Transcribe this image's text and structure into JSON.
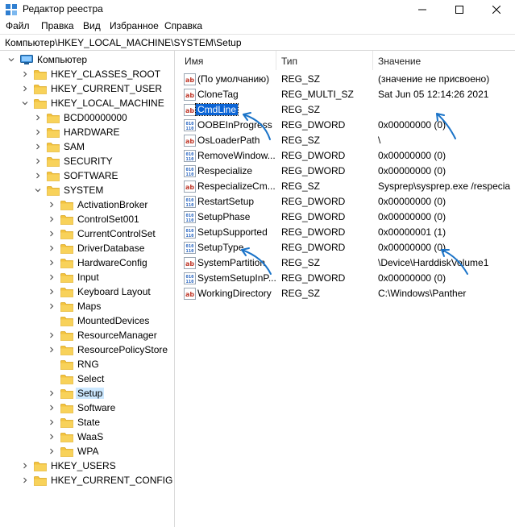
{
  "window": {
    "title": "Редактор реестра",
    "icon": "regedit-icon",
    "controls": [
      "minimize-icon",
      "maximize-icon",
      "close-icon"
    ]
  },
  "menu": {
    "items": [
      "Файл",
      "Правка",
      "Вид",
      "Избранное",
      "Справка"
    ]
  },
  "address": {
    "path": "Компьютер\\HKEY_LOCAL_MACHINE\\SYSTEM\\Setup"
  },
  "tree": {
    "nodes": [
      {
        "label": "Компьютер",
        "depth": 0,
        "expanded": true,
        "icon": "computer-icon"
      },
      {
        "label": "HKEY_CLASSES_ROOT",
        "depth": 1,
        "expanded": false,
        "icon": "folder-icon"
      },
      {
        "label": "HKEY_CURRENT_USER",
        "depth": 1,
        "expanded": false,
        "icon": "folder-icon"
      },
      {
        "label": "HKEY_LOCAL_MACHINE",
        "depth": 1,
        "expanded": true,
        "icon": "folder-icon"
      },
      {
        "label": "BCD00000000",
        "depth": 2,
        "expanded": false,
        "icon": "folder-icon"
      },
      {
        "label": "HARDWARE",
        "depth": 2,
        "expanded": false,
        "icon": "folder-icon"
      },
      {
        "label": "SAM",
        "depth": 2,
        "expanded": false,
        "icon": "folder-icon"
      },
      {
        "label": "SECURITY",
        "depth": 2,
        "expanded": false,
        "icon": "folder-icon"
      },
      {
        "label": "SOFTWARE",
        "depth": 2,
        "expanded": false,
        "icon": "folder-icon"
      },
      {
        "label": "SYSTEM",
        "depth": 2,
        "expanded": true,
        "icon": "folder-icon"
      },
      {
        "label": "ActivationBroker",
        "depth": 3,
        "expanded": false,
        "icon": "folder-icon"
      },
      {
        "label": "ControlSet001",
        "depth": 3,
        "expanded": false,
        "icon": "folder-icon"
      },
      {
        "label": "CurrentControlSet",
        "depth": 3,
        "expanded": false,
        "icon": "folder-icon"
      },
      {
        "label": "DriverDatabase",
        "depth": 3,
        "expanded": false,
        "icon": "folder-icon"
      },
      {
        "label": "HardwareConfig",
        "depth": 3,
        "expanded": false,
        "icon": "folder-icon"
      },
      {
        "label": "Input",
        "depth": 3,
        "expanded": false,
        "icon": "folder-icon"
      },
      {
        "label": "Keyboard Layout",
        "depth": 3,
        "expanded": false,
        "icon": "folder-icon"
      },
      {
        "label": "Maps",
        "depth": 3,
        "expanded": false,
        "icon": "folder-icon"
      },
      {
        "label": "MountedDevices",
        "depth": 3,
        "leaf": true,
        "icon": "folder-icon"
      },
      {
        "label": "ResourceManager",
        "depth": 3,
        "expanded": false,
        "icon": "folder-icon"
      },
      {
        "label": "ResourcePolicyStore",
        "depth": 3,
        "expanded": false,
        "icon": "folder-icon"
      },
      {
        "label": "RNG",
        "depth": 3,
        "leaf": true,
        "icon": "folder-icon"
      },
      {
        "label": "Select",
        "depth": 3,
        "leaf": true,
        "icon": "folder-icon"
      },
      {
        "label": "Setup",
        "depth": 3,
        "expanded": false,
        "selected": true,
        "icon": "folder-icon"
      },
      {
        "label": "Software",
        "depth": 3,
        "expanded": false,
        "icon": "folder-icon"
      },
      {
        "label": "State",
        "depth": 3,
        "expanded": false,
        "icon": "folder-icon"
      },
      {
        "label": "WaaS",
        "depth": 3,
        "expanded": false,
        "icon": "folder-icon"
      },
      {
        "label": "WPA",
        "depth": 3,
        "expanded": false,
        "icon": "folder-icon"
      },
      {
        "label": "HKEY_USERS",
        "depth": 1,
        "expanded": false,
        "icon": "folder-icon"
      },
      {
        "label": "HKEY_CURRENT_CONFIG",
        "depth": 1,
        "expanded": false,
        "icon": "folder-icon"
      }
    ]
  },
  "list": {
    "columns": [
      "Имя",
      "Тип",
      "Значение"
    ],
    "rows": [
      {
        "icon": "string-value-icon",
        "name": "(По умолчанию)",
        "type": "REG_SZ",
        "data": "(значение не присвоено)"
      },
      {
        "icon": "string-value-icon",
        "name": "CloneTag",
        "type": "REG_MULTI_SZ",
        "data": "Sat Jun 05 12:14:26 2021"
      },
      {
        "icon": "string-value-icon",
        "name": "CmdLine",
        "type": "REG_SZ",
        "data": "",
        "selected": true
      },
      {
        "icon": "binary-value-icon",
        "name": "OOBEInProgress",
        "type": "REG_DWORD",
        "data": "0x00000000 (0)"
      },
      {
        "icon": "string-value-icon",
        "name": "OsLoaderPath",
        "type": "REG_SZ",
        "data": "\\"
      },
      {
        "icon": "binary-value-icon",
        "name": "RemoveWindow...",
        "type": "REG_DWORD",
        "data": "0x00000000 (0)"
      },
      {
        "icon": "binary-value-icon",
        "name": "Respecialize",
        "type": "REG_DWORD",
        "data": "0x00000000 (0)"
      },
      {
        "icon": "string-value-icon",
        "name": "RespecializeCm...",
        "type": "REG_SZ",
        "data": "Sysprep\\sysprep.exe /respecia"
      },
      {
        "icon": "binary-value-icon",
        "name": "RestartSetup",
        "type": "REG_DWORD",
        "data": "0x00000000 (0)"
      },
      {
        "icon": "binary-value-icon",
        "name": "SetupPhase",
        "type": "REG_DWORD",
        "data": "0x00000000 (0)"
      },
      {
        "icon": "binary-value-icon",
        "name": "SetupSupported",
        "type": "REG_DWORD",
        "data": "0x00000001 (1)"
      },
      {
        "icon": "binary-value-icon",
        "name": "SetupType",
        "type": "REG_DWORD",
        "data": "0x00000000 (0)"
      },
      {
        "icon": "string-value-icon",
        "name": "SystemPartition",
        "type": "REG_SZ",
        "data": "\\Device\\HarddiskVolume1"
      },
      {
        "icon": "binary-value-icon",
        "name": "SystemSetupInP...",
        "type": "REG_DWORD",
        "data": "0x00000000 (0)"
      },
      {
        "icon": "string-value-icon",
        "name": "WorkingDirectory",
        "type": "REG_SZ",
        "data": "C:\\Windows\\Panther"
      }
    ]
  },
  "colors": {
    "annotation_arrow": "#1a73c8",
    "selection_focus": "#0a64d6",
    "selection_tree": "#cce8ff",
    "folder": "#f3c33e"
  }
}
